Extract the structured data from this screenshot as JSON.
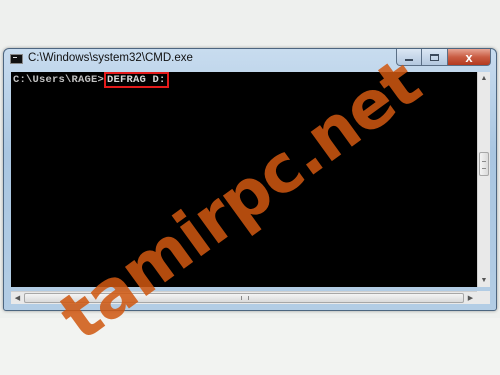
{
  "window": {
    "title": "C:\\Windows\\system32\\CMD.exe",
    "icons": {
      "app": "cmd-icon",
      "minimize": "minimize-icon",
      "maximize": "maximize-icon",
      "close": "close-icon"
    },
    "close_glyph": "x"
  },
  "console": {
    "prompt": "C:\\Users\\RAGE>",
    "command": "DEFRAG D:",
    "highlight_color": "#e31b1b"
  },
  "scrollbars": {
    "up_arrow": "▲",
    "down_arrow": "▼",
    "left_arrow": "◀",
    "right_arrow": "▶"
  },
  "watermark": {
    "text": "tamirpc.net",
    "color": "#cf5710"
  }
}
